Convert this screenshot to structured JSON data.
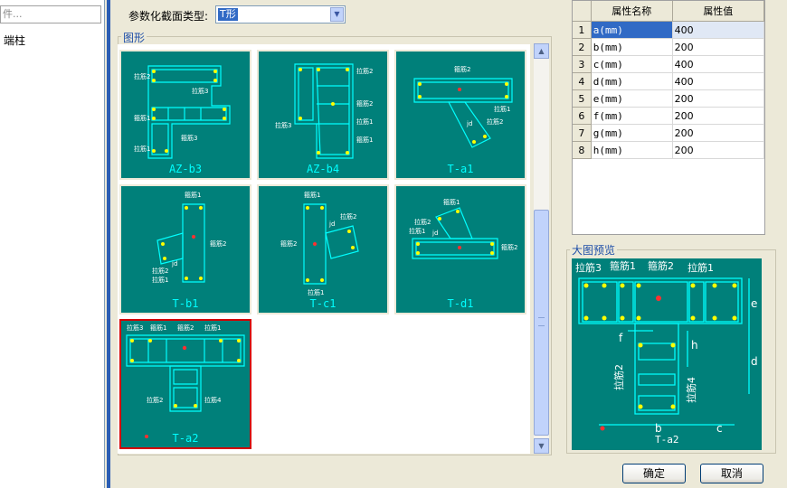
{
  "left_panel": {
    "search_text": "件...",
    "item": "端柱"
  },
  "section": {
    "label": "参数化截面类型:",
    "value": "T形"
  },
  "gallery": {
    "title": "图形",
    "thumbnails": [
      {
        "caption": "AZ-b3",
        "labels": [
          "拉筋3",
          "箍筋3",
          "箍筋1",
          "拉筋1",
          "拉筋2"
        ]
      },
      {
        "caption": "AZ-b4",
        "labels": [
          "拉筋2",
          "拉筋3",
          "箍筋2",
          "箍筋1",
          "拉筋1"
        ]
      },
      {
        "caption": "T-a1",
        "labels": [
          "箍筋2",
          "jd",
          "拉筋2",
          "拉筋1"
        ]
      },
      {
        "caption": "T-b1",
        "labels": [
          "箍筋1",
          "箍筋2",
          "jd",
          "拉筋2",
          "拉筋1"
        ]
      },
      {
        "caption": "T-c1",
        "labels": [
          "箍筋1",
          "拉筋2",
          "jd",
          "箍筋2",
          "拉筋1"
        ]
      },
      {
        "caption": "T-d1",
        "labels": [
          "箍筋1",
          "拉筋2",
          "拉筋1",
          "jd",
          "箍筋2"
        ]
      },
      {
        "caption": "T-a2",
        "labels": [
          "拉筋3",
          "箍筋1",
          "箍筋2",
          "拉筋1",
          "拉筋2",
          "拉筋4"
        ],
        "selected": true
      }
    ]
  },
  "properties": {
    "headers": [
      "属性名称",
      "属性值"
    ],
    "rows": [
      {
        "index": "1",
        "name": "a(mm)",
        "value": "400"
      },
      {
        "index": "2",
        "name": "b(mm)",
        "value": "200"
      },
      {
        "index": "3",
        "name": "c(mm)",
        "value": "400"
      },
      {
        "index": "4",
        "name": "d(mm)",
        "value": "400"
      },
      {
        "index": "5",
        "name": "e(mm)",
        "value": "200"
      },
      {
        "index": "6",
        "name": "f(mm)",
        "value": "200"
      },
      {
        "index": "7",
        "name": "g(mm)",
        "value": "200"
      },
      {
        "index": "8",
        "name": "h(mm)",
        "value": "200"
      }
    ]
  },
  "preview": {
    "title": "大图预览",
    "caption": "T-a2",
    "labels": {
      "tie3": "拉筋3",
      "stirrup1": "箍筋1",
      "stirrup2": "箍筋2",
      "tie1": "拉筋1",
      "tie2": "拉筋2",
      "tie4": "拉筋4"
    },
    "dims": {
      "e": "e",
      "d": "d",
      "f": "f",
      "h": "h",
      "b": "b",
      "c": "c"
    }
  },
  "buttons": {
    "ok": "确定",
    "cancel": "取消"
  },
  "colors": {
    "drawing_bg": "#00807a",
    "line": "#00ffff",
    "rebar": "#ffff00",
    "selected_border": "#d40000",
    "accent": "#316ac5"
  },
  "icons": {
    "dropdown": "chevron-down-icon",
    "scroll_up": "arrow-up-icon",
    "scroll_down": "arrow-down-icon"
  }
}
